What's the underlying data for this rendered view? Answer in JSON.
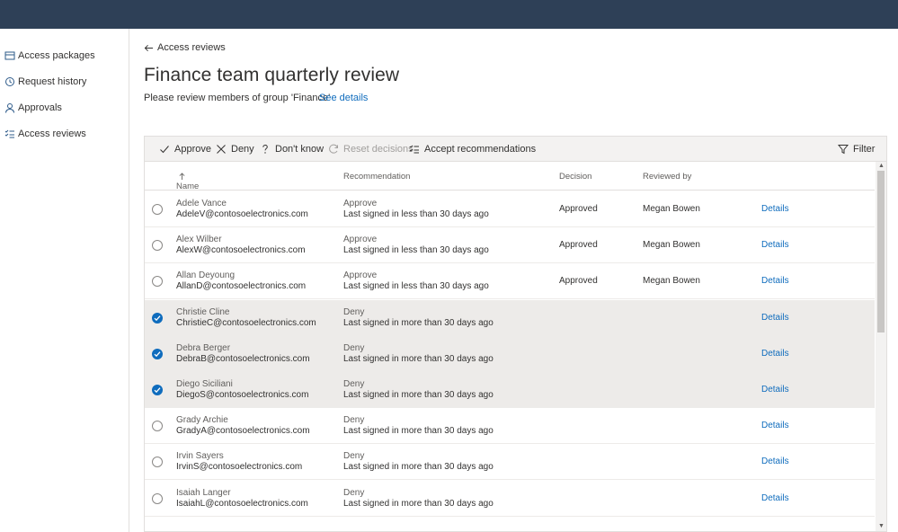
{
  "sidebar": {
    "items": [
      {
        "label": "Access packages",
        "icon": "package-icon"
      },
      {
        "label": "Request history",
        "icon": "history-icon"
      },
      {
        "label": "Approvals",
        "icon": "person-icon"
      },
      {
        "label": "Access reviews",
        "icon": "checklist-icon"
      }
    ]
  },
  "breadcrumb": {
    "back_label": "Access reviews"
  },
  "page": {
    "title": "Finance team quarterly review",
    "subtitle": "Please review members of group 'Finance'",
    "see_details": "See details"
  },
  "toolbar": {
    "approve": "Approve",
    "deny": "Deny",
    "dont_know": "Don't know",
    "reset": "Reset decisions",
    "accept": "Accept recommendations",
    "filter": "Filter"
  },
  "table": {
    "columns": {
      "name": "Name",
      "recommendation": "Recommendation",
      "decision": "Decision",
      "reviewed_by": "Reviewed by"
    },
    "rows": [
      {
        "name": "Adele Vance",
        "email": "AdeleV@contosoelectronics.com",
        "rec": "Approve",
        "rec_detail": "Last signed in less than 30 days ago",
        "decision": "Approved",
        "reviewed_by": "Megan Bowen",
        "details": "Details",
        "selected": false
      },
      {
        "name": "Alex Wilber",
        "email": "AlexW@contosoelectronics.com",
        "rec": "Approve",
        "rec_detail": "Last signed in less than 30 days ago",
        "decision": "Approved",
        "reviewed_by": "Megan Bowen",
        "details": "Details",
        "selected": false
      },
      {
        "name": "Allan Deyoung",
        "email": "AllanD@contosoelectronics.com",
        "rec": "Approve",
        "rec_detail": "Last signed in less than 30 days ago",
        "decision": "Approved",
        "reviewed_by": "Megan Bowen",
        "details": "Details",
        "selected": false
      },
      {
        "name": "Christie Cline",
        "email": "ChristieC@contosoelectronics.com",
        "rec": "Deny",
        "rec_detail": "Last signed in more than 30 days ago",
        "decision": "",
        "reviewed_by": "",
        "details": "Details",
        "selected": true
      },
      {
        "name": "Debra Berger",
        "email": "DebraB@contosoelectronics.com",
        "rec": "Deny",
        "rec_detail": "Last signed in more than 30 days ago",
        "decision": "",
        "reviewed_by": "",
        "details": "Details",
        "selected": true
      },
      {
        "name": "Diego Siciliani",
        "email": "DiegoS@contosoelectronics.com",
        "rec": "Deny",
        "rec_detail": "Last signed in more than 30 days ago",
        "decision": "",
        "reviewed_by": "",
        "details": "Details",
        "selected": true
      },
      {
        "name": "Grady Archie",
        "email": "GradyA@contosoelectronics.com",
        "rec": "Deny",
        "rec_detail": "Last signed in more than 30 days ago",
        "decision": "",
        "reviewed_by": "",
        "details": "Details",
        "selected": false
      },
      {
        "name": "Irvin Sayers",
        "email": "IrvinS@contosoelectronics.com",
        "rec": "Deny",
        "rec_detail": "Last signed in more than 30 days ago",
        "decision": "",
        "reviewed_by": "",
        "details": "Details",
        "selected": false
      },
      {
        "name": "Isaiah Langer",
        "email": "IsaiahL@contosoelectronics.com",
        "rec": "Deny",
        "rec_detail": "Last signed in more than 30 days ago",
        "decision": "",
        "reviewed_by": "",
        "details": "Details",
        "selected": false
      }
    ]
  },
  "colors": {
    "topbar": "#2e4057",
    "accent": "#0f6cbd",
    "selected_row": "#edebe9"
  }
}
